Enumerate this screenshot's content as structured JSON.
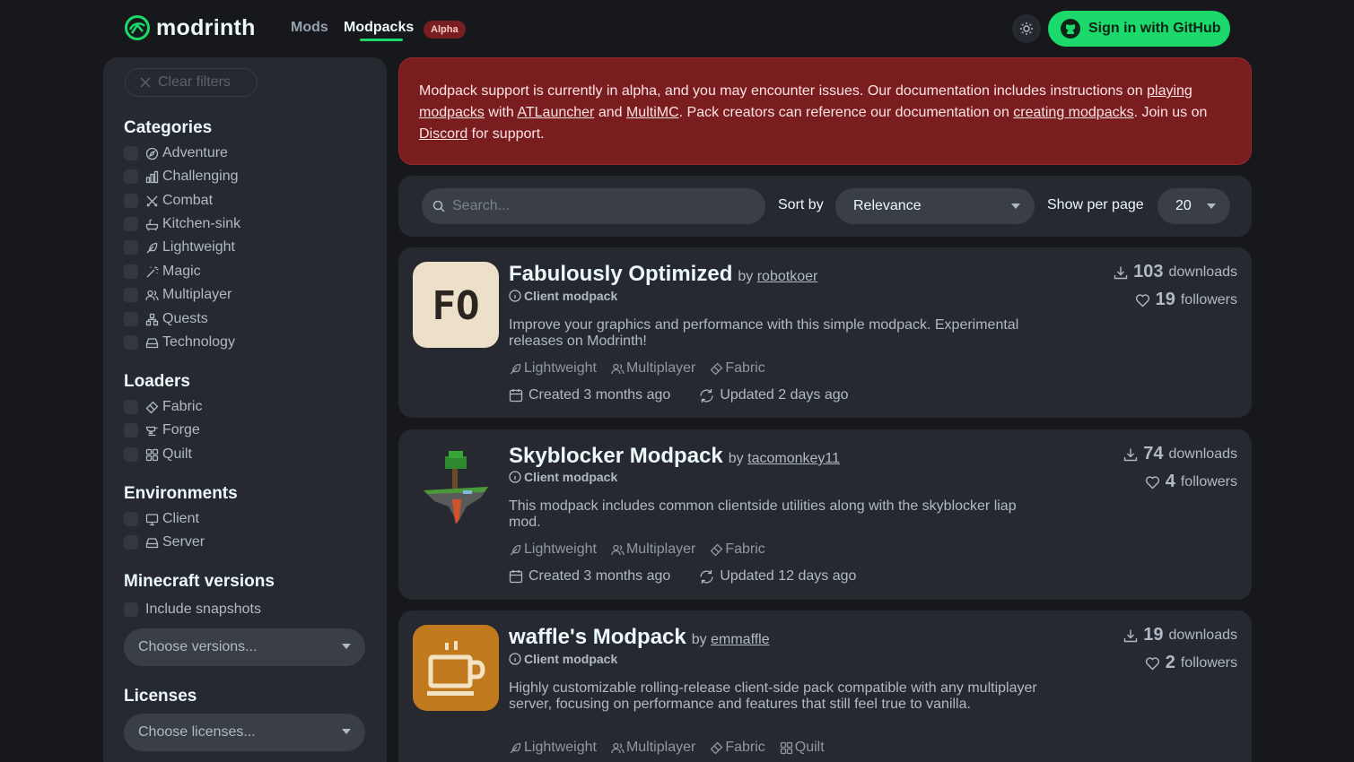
{
  "nav": {
    "logo_text": "modrinth",
    "mods_label": "Mods",
    "modpacks_label": "Modpacks",
    "alpha_badge": "Alpha",
    "signin_label": "Sign in with GitHub",
    "brand_color": "#1bd96a"
  },
  "sidebar": {
    "clear_filters": "Clear filters",
    "categories_heading": "Categories",
    "categories": [
      "Adventure",
      "Challenging",
      "Combat",
      "Kitchen-sink",
      "Lightweight",
      "Magic",
      "Multiplayer",
      "Quests",
      "Technology"
    ],
    "loaders_heading": "Loaders",
    "loaders": [
      "Fabric",
      "Forge",
      "Quilt"
    ],
    "environments_heading": "Environments",
    "environments": [
      "Client",
      "Server"
    ],
    "versions_heading": "Minecraft versions",
    "include_snapshots": "Include snapshots",
    "versions_placeholder": "Choose versions...",
    "licenses_heading": "Licenses",
    "licenses_placeholder": "Choose licenses..."
  },
  "alert": {
    "t1": "Modpack support is currently in alpha, and you may encounter issues. Our documentation includes instructions on ",
    "l1": "playing modpacks",
    "t2": " with ",
    "l2": "ATLauncher",
    "t3": " and ",
    "l3": "MultiMC",
    "t4": ". Pack creators can reference our documentation on ",
    "l4": "creating modpacks",
    "t5": ". Join us on ",
    "l5": "Discord",
    "t6": " for support."
  },
  "search": {
    "placeholder": "Search...",
    "sort_label": "Sort by",
    "sort_value": "Relevance",
    "per_page_label": "Show per page",
    "per_page_value": "20"
  },
  "results": [
    {
      "title": "Fabulously Optimized",
      "by": "by",
      "author": "robotkoer",
      "env": "Client modpack",
      "desc": "Improve your graphics and performance with this simple modpack. Experimental releases on Modrinth!",
      "tags": [
        "Lightweight",
        "Multiplayer",
        "Fabric"
      ],
      "created": "Created 3 months ago",
      "updated": "Updated 2 days ago",
      "downloads": "103",
      "downloads_label": "downloads",
      "followers": "19",
      "followers_label": "followers",
      "icon_text": "FO"
    },
    {
      "title": "Skyblocker Modpack",
      "by": "by",
      "author": "tacomonkey11",
      "env": "Client modpack",
      "desc": "This modpack includes common clientside utilities along with the skyblocker liap mod.",
      "tags": [
        "Lightweight",
        "Multiplayer",
        "Fabric"
      ],
      "created": "Created 3 months ago",
      "updated": "Updated 12 days ago",
      "downloads": "74",
      "downloads_label": "downloads",
      "followers": "4",
      "followers_label": "followers"
    },
    {
      "title": "waffle's Modpack",
      "by": "by",
      "author": "emmaffle",
      "env": "Client modpack",
      "desc": "Highly customizable rolling-release client-side pack compatible with any multiplayer server, focusing on performance and features that still feel true to vanilla.",
      "tags": [
        "Lightweight",
        "Multiplayer",
        "Fabric",
        "Quilt"
      ],
      "downloads": "19",
      "downloads_label": "downloads",
      "followers": "2",
      "followers_label": "followers"
    }
  ]
}
